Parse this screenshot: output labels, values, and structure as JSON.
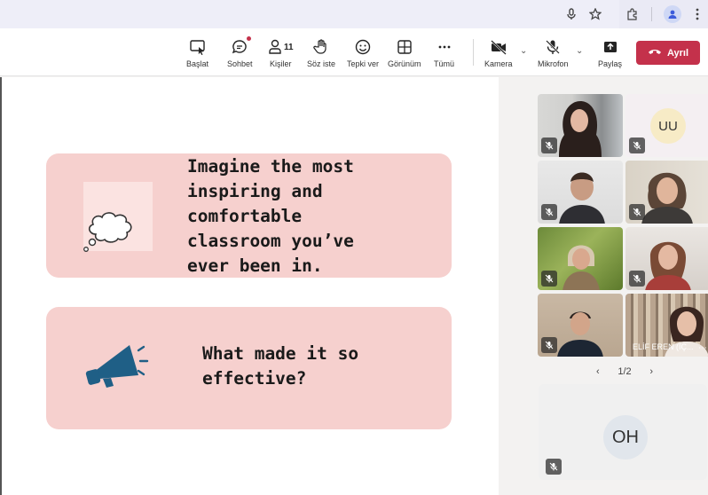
{
  "colors": {
    "card": "#f6d0ce",
    "leave": "#c4314b",
    "megaphone": "#1f5f86"
  },
  "browser": {
    "icons": [
      "microphone-icon",
      "star-icon",
      "extensions-icon",
      "profile-icon",
      "more-vertical-icon"
    ]
  },
  "toolbar": {
    "items": [
      {
        "label": "Başlat",
        "icon": "present-icon"
      },
      {
        "label": "Sohbet",
        "icon": "chat-icon"
      },
      {
        "label": "Kişiler",
        "icon": "people-icon",
        "count": "11"
      },
      {
        "label": "Söz iste",
        "icon": "raise-hand-icon"
      },
      {
        "label": "Tepki ver",
        "icon": "emoji-icon"
      },
      {
        "label": "Görünüm",
        "icon": "layout-icon"
      },
      {
        "label": "Tümü",
        "icon": "more-horizontal-icon"
      },
      {
        "label": "Kamera",
        "icon": "camera-off-icon"
      },
      {
        "label": "Mikrofon",
        "icon": "mic-off-icon"
      },
      {
        "label": "Paylaş",
        "icon": "share-icon"
      }
    ],
    "leave_label": "Ayrıl"
  },
  "slide": {
    "card1_text": "Imagine the most\ninspiring and\ncomfortable\nclassroom you’ve\never been in.",
    "card2_text": "What made it so\neffective?"
  },
  "gallery": {
    "tiles": [
      {
        "type": "video"
      },
      {
        "type": "avatar",
        "initials": "UU"
      },
      {
        "type": "video"
      },
      {
        "type": "video"
      },
      {
        "type": "video"
      },
      {
        "type": "video"
      },
      {
        "type": "video"
      },
      {
        "type": "video",
        "name": "ELİF EREN (İÇ..."
      }
    ],
    "pager": "1/2",
    "big_tile_initials": "OH"
  }
}
